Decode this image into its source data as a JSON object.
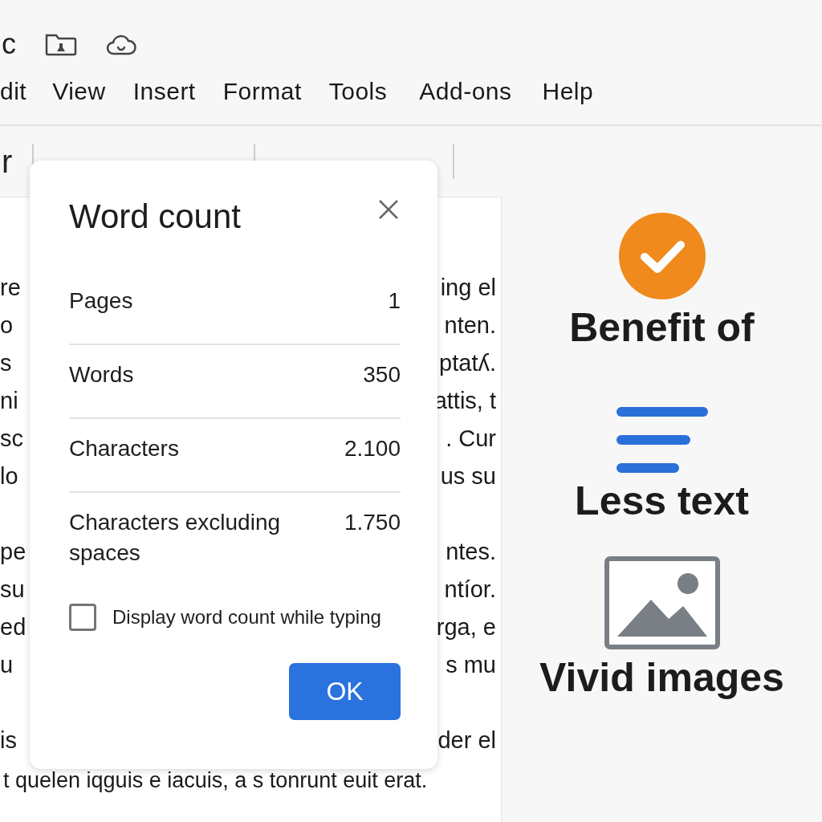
{
  "title_fragment": "c",
  "menu": [
    {
      "label": "dit"
    },
    {
      "label": "View"
    },
    {
      "label": "Insert"
    },
    {
      "label": "Format"
    },
    {
      "label": "Tools"
    },
    {
      "label": "Add-ons"
    },
    {
      "label": "Help"
    }
  ],
  "toolbar": {
    "fragment": "r"
  },
  "document": {
    "paragraphs": [
      {
        "lines": [
          {
            "left": "re",
            "right": "ing el"
          },
          {
            "left": "o",
            "right": "nten."
          },
          {
            "left": "s",
            "right": "ptatʎ."
          },
          {
            "left": "ni",
            "right": "attis, t"
          },
          {
            "left": "sc",
            "right": ". Cur"
          },
          {
            "left": "lo",
            "right": "us su"
          }
        ]
      },
      {
        "lines": [
          {
            "left": "pe",
            "right": "ntes."
          },
          {
            "left": "su",
            "right": "ntíor."
          },
          {
            "left": "ed",
            "right": "rga, e"
          },
          {
            "left": "u",
            "right": "s mu"
          }
        ]
      },
      {
        "lines": [
          {
            "left": "is",
            "right": "der el"
          }
        ]
      }
    ],
    "last_line": "t quelen iqguis e iacuis, a s tonrunt euit erat."
  },
  "dialog": {
    "title": "Word count",
    "stats": [
      {
        "label": "Pages",
        "value": "1"
      },
      {
        "label": "Words",
        "value": "350"
      },
      {
        "label": "Characters",
        "value": "2.100"
      },
      {
        "label": "Characters excluding spaces",
        "value": "1.750"
      }
    ],
    "option": {
      "label": "Display word count while typing",
      "checked": false
    },
    "button": "OK"
  },
  "benefits": [
    {
      "kind": "check",
      "label": "Benefit of"
    },
    {
      "kind": "lines",
      "label": "Less text"
    },
    {
      "kind": "image",
      "label": "Vivid images"
    }
  ]
}
